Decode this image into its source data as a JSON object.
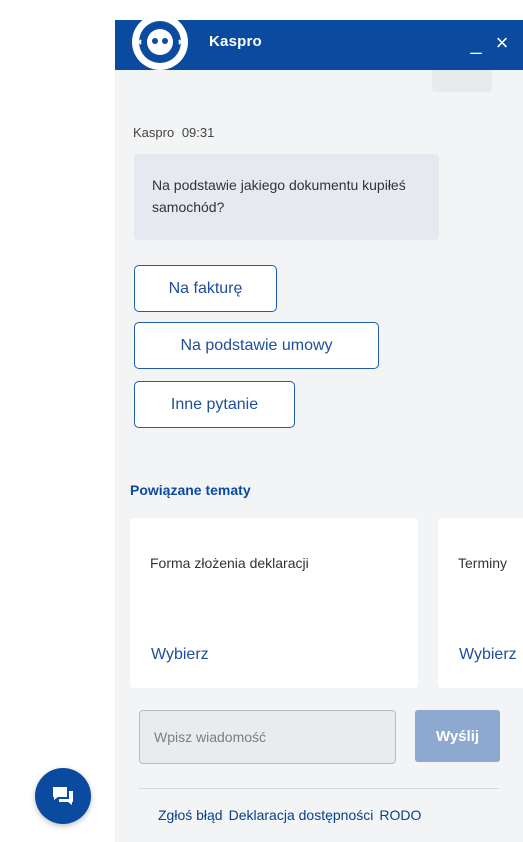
{
  "header": {
    "title": "Kaspro",
    "minimize_label": "_",
    "close_label": "×",
    "avatar_icon": "bot-face-icon",
    "background": "#0a4ba0"
  },
  "conversation": {
    "sender": "Kaspro",
    "time": "09:31",
    "message": "Na podstawie jakiego dokumentu kupiłeś samochód?",
    "options": [
      {
        "label": "Na fakturę"
      },
      {
        "label": "Na podstawie umowy"
      },
      {
        "label": "Inne pytanie"
      }
    ]
  },
  "related": {
    "title": "Powiązane tematy",
    "cards": [
      {
        "title": "Forma złożenia deklaracji",
        "action": "Wybierz"
      },
      {
        "title": "Terminy",
        "action": "Wybierz"
      }
    ]
  },
  "composer": {
    "placeholder": "Wpisz wiadomość",
    "send_label": "Wyślij"
  },
  "footer": {
    "links": [
      "Zgłoś błąd",
      "Deklaracja dostępności",
      "RODO"
    ]
  },
  "launcher": {
    "icon": "chat-bubbles-icon"
  }
}
